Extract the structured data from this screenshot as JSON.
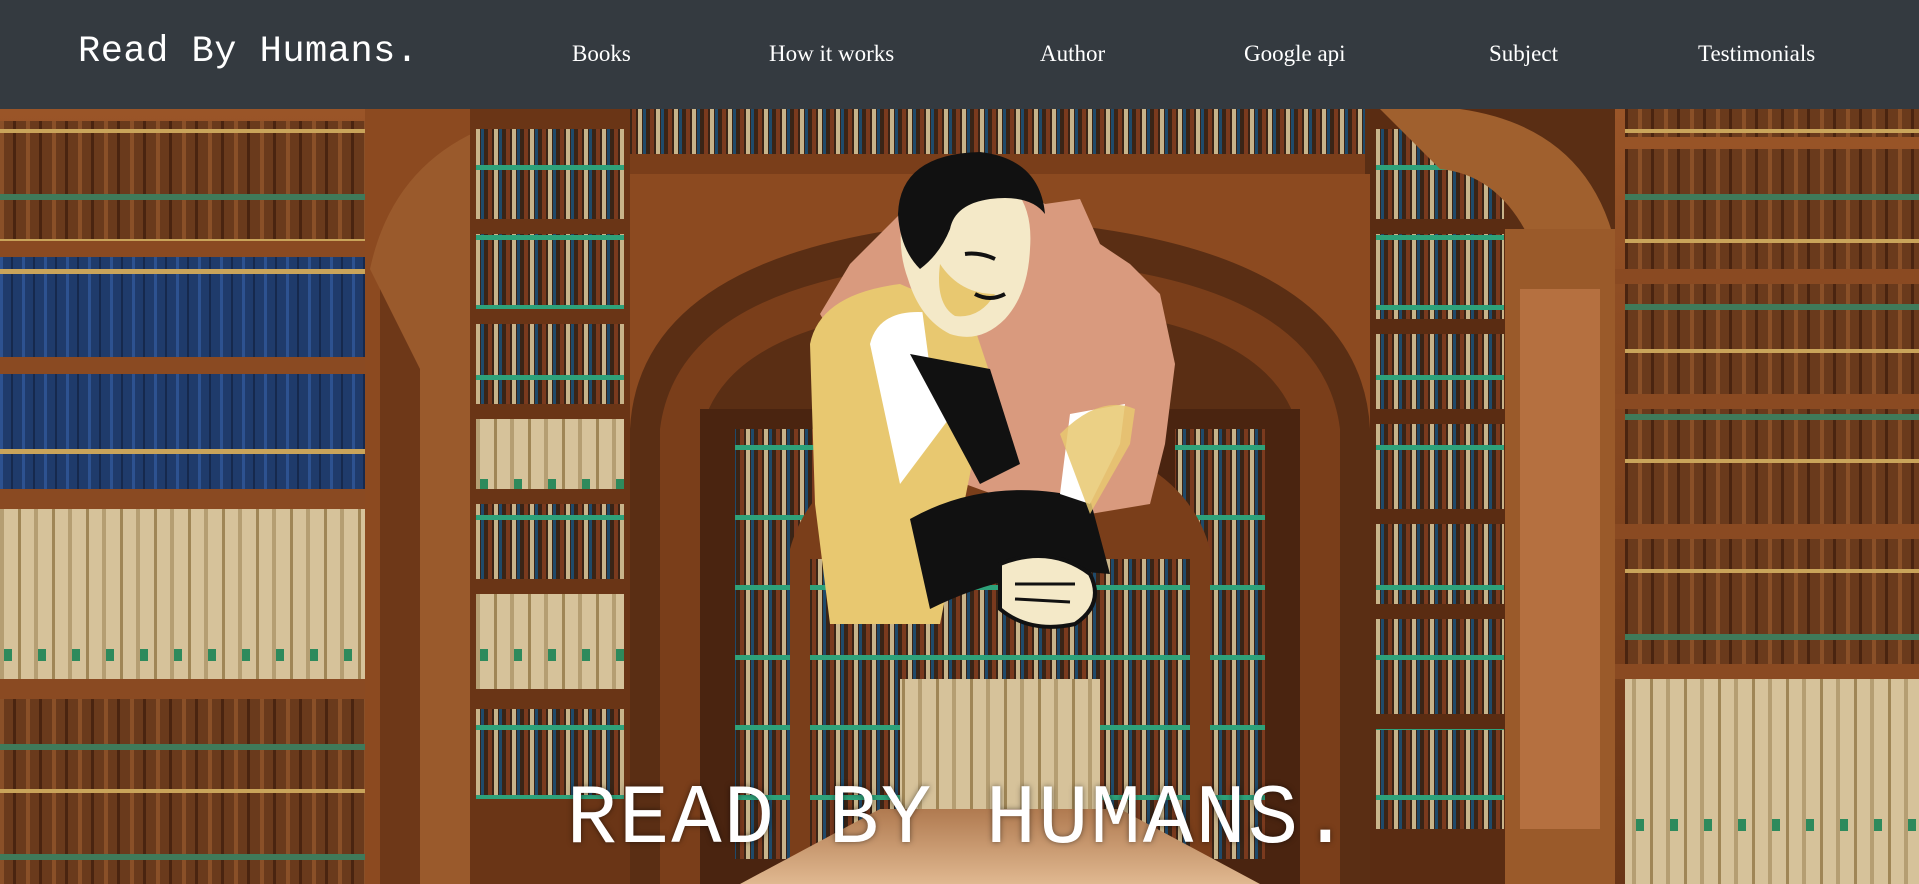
{
  "nav": {
    "brand": "Read By Humans.",
    "links": [
      "Books",
      "How it works",
      "Author",
      "Google api",
      "Subject",
      "Testimonials"
    ]
  },
  "hero": {
    "title": "READ BY HUMANS.",
    "background": "library-bookshelves-image",
    "illustration": "man-reading-book-illustration"
  },
  "colors": {
    "navbar": "#343a40",
    "nav_text": "#ffffff",
    "wood": "#8a4a22",
    "illustration_bg": "#d99a7e",
    "illustration_skin": "#e8c870"
  }
}
